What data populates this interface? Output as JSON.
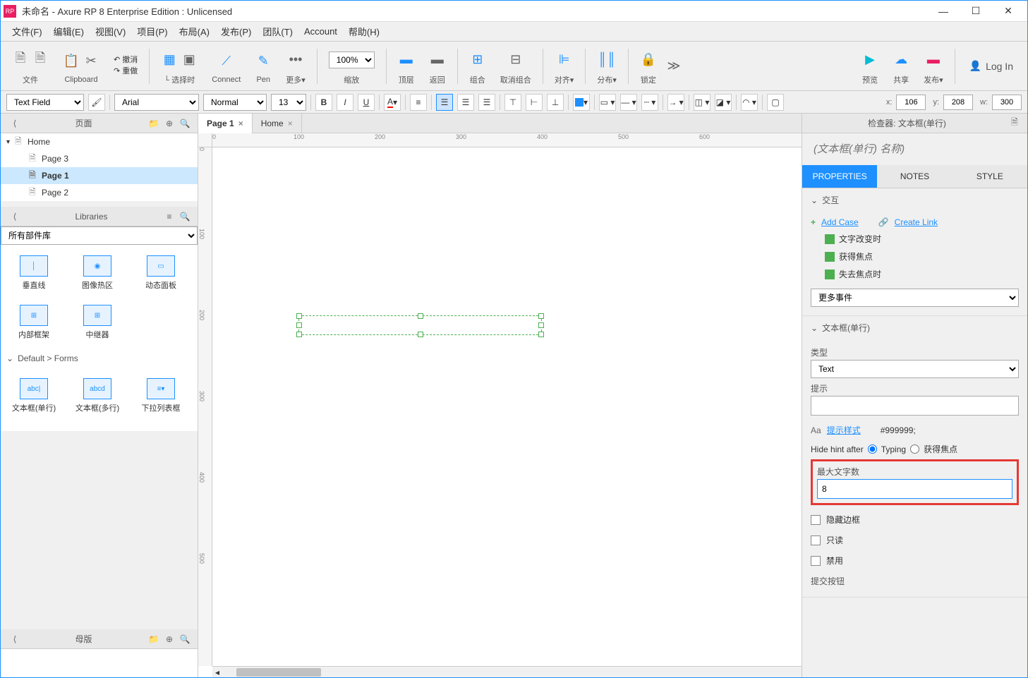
{
  "titlebar": {
    "logo_text": "RP",
    "title": "未命名 - Axure RP 8 Enterprise Edition : Unlicensed"
  },
  "menu": {
    "file": "文件(F)",
    "edit": "编辑(E)",
    "view": "视图(V)",
    "project": "项目(P)",
    "arrange": "布局(A)",
    "publish": "发布(P)",
    "team": "团队(T)",
    "account": "Account",
    "help": "帮助(H)"
  },
  "toolbar": {
    "file": "文件",
    "clipboard": "Clipboard",
    "undo": "撤消",
    "redo": "重做",
    "select": "选择时",
    "connect": "Connect",
    "pen": "Pen",
    "more": "更多▾",
    "zoom": "缩放",
    "zoom_value": "100%",
    "front": "顶层",
    "back": "返回",
    "group": "组合",
    "ungroup": "取消组合",
    "align": "对齐▾",
    "distribute": "分布▾",
    "lock": "锁定",
    "preview": "预览",
    "share": "共享",
    "publish": "发布▾",
    "more_arrow": "≫",
    "login": "Log In"
  },
  "formatbar": {
    "widget_type": "Text Field",
    "font": "Arial",
    "weight": "Normal",
    "size": "13",
    "x_label": "x:",
    "x_value": "106",
    "y_label": "y:",
    "y_value": "208",
    "w_label": "w:",
    "w_value": "300"
  },
  "left": {
    "pages_title": "页面",
    "libraries_title": "Libraries",
    "masters_title": "母版",
    "lib_selector": "所有部件库",
    "tree": [
      {
        "label": "Home",
        "level": 0,
        "expanded": true,
        "selected": false
      },
      {
        "label": "Page 3",
        "level": 1,
        "selected": false
      },
      {
        "label": "Page 1",
        "level": 1,
        "selected": true
      },
      {
        "label": "Page 2",
        "level": 1,
        "selected": false
      }
    ],
    "widgets_row1": [
      "垂直线",
      "图像热区",
      "动态面板"
    ],
    "widgets_row2": [
      "内部框架",
      "中继器"
    ],
    "forms_category": "Default > Forms",
    "forms": [
      "文本框(单行)",
      "文本框(多行)",
      "下拉列表框"
    ]
  },
  "canvas": {
    "tabs": [
      {
        "label": "Page 1",
        "active": true
      },
      {
        "label": "Home",
        "active": false
      }
    ],
    "ruler_h": [
      "0",
      "100",
      "200",
      "300",
      "400",
      "500",
      "600"
    ],
    "ruler_v": [
      "0",
      "100",
      "200",
      "300",
      "400",
      "500"
    ]
  },
  "inspector": {
    "header": "检查器: 文本框(单行)",
    "name_placeholder": "(文本框(单行) 名称)",
    "tabs": {
      "properties": "PROPERTIES",
      "notes": "NOTES",
      "style": "STYLE"
    },
    "interactions": {
      "title": "交互",
      "add_case": "Add Case",
      "create_link": "Create Link",
      "events": [
        "文字改变时",
        "获得焦点",
        "失去焦点时"
      ],
      "more_events": "更多事件"
    },
    "textfield_section": {
      "title": "文本框(单行)",
      "type_label": "类型",
      "type_value": "Text",
      "hint_label": "提示",
      "hint_value": "",
      "hint_style": "提示样式",
      "hint_color": "#999999;",
      "hide_hint_label": "Hide hint after",
      "typing_option": "Typing",
      "focus_option": "获得焦点",
      "max_length_label": "最大文字数",
      "max_length_value": "8",
      "hide_border": "隐藏边框",
      "readonly": "只读",
      "disabled": "禁用",
      "submit_button": "提交按钮"
    }
  }
}
